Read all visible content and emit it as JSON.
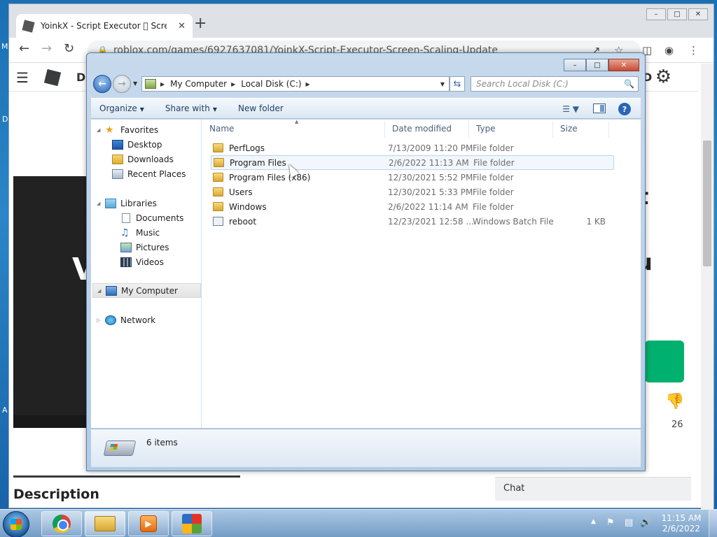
{
  "desktop": {
    "fragment_top": "M",
    "fragment_mid": "D",
    "fragment_low": "A"
  },
  "chrome": {
    "tab_title": "YoinkX - Script Executor \u0000 Screen Scaling Update",
    "tab_close": "✕",
    "new_tab": "+",
    "url": "roblox.com/games/6927637081/YoinkX-Script-Executor-Screen-Scaling-Update",
    "window_buttons": [
      "–",
      "□",
      "✕"
    ]
  },
  "roblox": {
    "header_text": "D",
    "header_right_text": "D",
    "big_text_1": "t",
    "big_text_2": "u",
    "video_letter": "V",
    "dislike_count": "26",
    "description_heading": "Description",
    "chat_label": "Chat"
  },
  "explorer": {
    "breadcrumbs": [
      "My Computer",
      "Local Disk (C:)"
    ],
    "search_placeholder": "Search Local Disk (C:)",
    "commands": {
      "organize": "Organize",
      "share_with": "Share with",
      "new_folder": "New folder"
    },
    "nav": {
      "favorites": "Favorites",
      "desktop": "Desktop",
      "downloads": "Downloads",
      "recent_places": "Recent Places",
      "libraries": "Libraries",
      "documents": "Documents",
      "music": "Music",
      "pictures": "Pictures",
      "videos": "Videos",
      "my_computer": "My Computer",
      "network": "Network"
    },
    "columns": {
      "name": "Name",
      "date_modified": "Date modified",
      "type": "Type",
      "size": "Size"
    },
    "files": [
      {
        "name": "PerfLogs",
        "date": "7/13/2009 11:20 PM",
        "type": "File folder",
        "size": "",
        "icon": "folder-icon"
      },
      {
        "name": "Program Files",
        "date": "2/6/2022 11:13 AM",
        "type": "File folder",
        "size": "",
        "icon": "folder-icon"
      },
      {
        "name": "Program Files (x86)",
        "date": "12/30/2021 5:52 PM",
        "type": "File folder",
        "size": "",
        "icon": "folder-icon"
      },
      {
        "name": "Users",
        "date": "12/30/2021 5:33 PM",
        "type": "File folder",
        "size": "",
        "icon": "folder-icon"
      },
      {
        "name": "Windows",
        "date": "2/6/2022 11:14 AM",
        "type": "File folder",
        "size": "",
        "icon": "folder-icon"
      },
      {
        "name": "reboot",
        "date": "12/23/2021 12:58 ...",
        "type": "Windows Batch File",
        "size": "1 KB",
        "icon": "batch-file-icon"
      }
    ],
    "status": "6 items",
    "hovered_row": "Program Files"
  },
  "taskbar": {
    "clock_time": "11:15 AM",
    "clock_date": "2/6/2022",
    "pinned": [
      "chrome-icon",
      "explorer-icon",
      "media-player-icon",
      "avg-icon"
    ]
  }
}
